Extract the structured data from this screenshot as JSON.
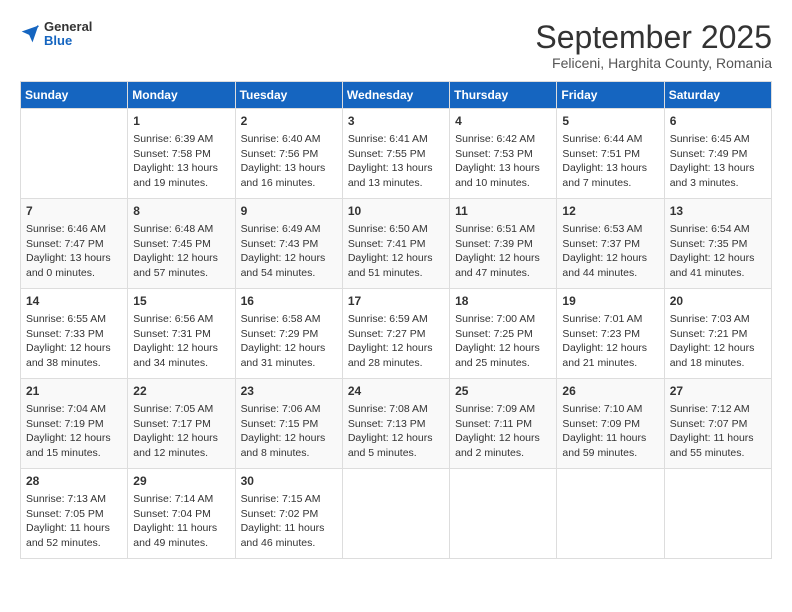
{
  "header": {
    "logo": {
      "general": "General",
      "blue": "Blue"
    },
    "title": "September 2025",
    "subtitle": "Feliceni, Harghita County, Romania"
  },
  "days_of_week": [
    "Sunday",
    "Monday",
    "Tuesday",
    "Wednesday",
    "Thursday",
    "Friday",
    "Saturday"
  ],
  "weeks": [
    [
      {
        "day": "",
        "info": ""
      },
      {
        "day": "1",
        "info": "Sunrise: 6:39 AM\nSunset: 7:58 PM\nDaylight: 13 hours\nand 19 minutes."
      },
      {
        "day": "2",
        "info": "Sunrise: 6:40 AM\nSunset: 7:56 PM\nDaylight: 13 hours\nand 16 minutes."
      },
      {
        "day": "3",
        "info": "Sunrise: 6:41 AM\nSunset: 7:55 PM\nDaylight: 13 hours\nand 13 minutes."
      },
      {
        "day": "4",
        "info": "Sunrise: 6:42 AM\nSunset: 7:53 PM\nDaylight: 13 hours\nand 10 minutes."
      },
      {
        "day": "5",
        "info": "Sunrise: 6:44 AM\nSunset: 7:51 PM\nDaylight: 13 hours\nand 7 minutes."
      },
      {
        "day": "6",
        "info": "Sunrise: 6:45 AM\nSunset: 7:49 PM\nDaylight: 13 hours\nand 3 minutes."
      }
    ],
    [
      {
        "day": "7",
        "info": "Sunrise: 6:46 AM\nSunset: 7:47 PM\nDaylight: 13 hours\nand 0 minutes."
      },
      {
        "day": "8",
        "info": "Sunrise: 6:48 AM\nSunset: 7:45 PM\nDaylight: 12 hours\nand 57 minutes."
      },
      {
        "day": "9",
        "info": "Sunrise: 6:49 AM\nSunset: 7:43 PM\nDaylight: 12 hours\nand 54 minutes."
      },
      {
        "day": "10",
        "info": "Sunrise: 6:50 AM\nSunset: 7:41 PM\nDaylight: 12 hours\nand 51 minutes."
      },
      {
        "day": "11",
        "info": "Sunrise: 6:51 AM\nSunset: 7:39 PM\nDaylight: 12 hours\nand 47 minutes."
      },
      {
        "day": "12",
        "info": "Sunrise: 6:53 AM\nSunset: 7:37 PM\nDaylight: 12 hours\nand 44 minutes."
      },
      {
        "day": "13",
        "info": "Sunrise: 6:54 AM\nSunset: 7:35 PM\nDaylight: 12 hours\nand 41 minutes."
      }
    ],
    [
      {
        "day": "14",
        "info": "Sunrise: 6:55 AM\nSunset: 7:33 PM\nDaylight: 12 hours\nand 38 minutes."
      },
      {
        "day": "15",
        "info": "Sunrise: 6:56 AM\nSunset: 7:31 PM\nDaylight: 12 hours\nand 34 minutes."
      },
      {
        "day": "16",
        "info": "Sunrise: 6:58 AM\nSunset: 7:29 PM\nDaylight: 12 hours\nand 31 minutes."
      },
      {
        "day": "17",
        "info": "Sunrise: 6:59 AM\nSunset: 7:27 PM\nDaylight: 12 hours\nand 28 minutes."
      },
      {
        "day": "18",
        "info": "Sunrise: 7:00 AM\nSunset: 7:25 PM\nDaylight: 12 hours\nand 25 minutes."
      },
      {
        "day": "19",
        "info": "Sunrise: 7:01 AM\nSunset: 7:23 PM\nDaylight: 12 hours\nand 21 minutes."
      },
      {
        "day": "20",
        "info": "Sunrise: 7:03 AM\nSunset: 7:21 PM\nDaylight: 12 hours\nand 18 minutes."
      }
    ],
    [
      {
        "day": "21",
        "info": "Sunrise: 7:04 AM\nSunset: 7:19 PM\nDaylight: 12 hours\nand 15 minutes."
      },
      {
        "day": "22",
        "info": "Sunrise: 7:05 AM\nSunset: 7:17 PM\nDaylight: 12 hours\nand 12 minutes."
      },
      {
        "day": "23",
        "info": "Sunrise: 7:06 AM\nSunset: 7:15 PM\nDaylight: 12 hours\nand 8 minutes."
      },
      {
        "day": "24",
        "info": "Sunrise: 7:08 AM\nSunset: 7:13 PM\nDaylight: 12 hours\nand 5 minutes."
      },
      {
        "day": "25",
        "info": "Sunrise: 7:09 AM\nSunset: 7:11 PM\nDaylight: 12 hours\nand 2 minutes."
      },
      {
        "day": "26",
        "info": "Sunrise: 7:10 AM\nSunset: 7:09 PM\nDaylight: 11 hours\nand 59 minutes."
      },
      {
        "day": "27",
        "info": "Sunrise: 7:12 AM\nSunset: 7:07 PM\nDaylight: 11 hours\nand 55 minutes."
      }
    ],
    [
      {
        "day": "28",
        "info": "Sunrise: 7:13 AM\nSunset: 7:05 PM\nDaylight: 11 hours\nand 52 minutes."
      },
      {
        "day": "29",
        "info": "Sunrise: 7:14 AM\nSunset: 7:04 PM\nDaylight: 11 hours\nand 49 minutes."
      },
      {
        "day": "30",
        "info": "Sunrise: 7:15 AM\nSunset: 7:02 PM\nDaylight: 11 hours\nand 46 minutes."
      },
      {
        "day": "",
        "info": ""
      },
      {
        "day": "",
        "info": ""
      },
      {
        "day": "",
        "info": ""
      },
      {
        "day": "",
        "info": ""
      }
    ]
  ]
}
